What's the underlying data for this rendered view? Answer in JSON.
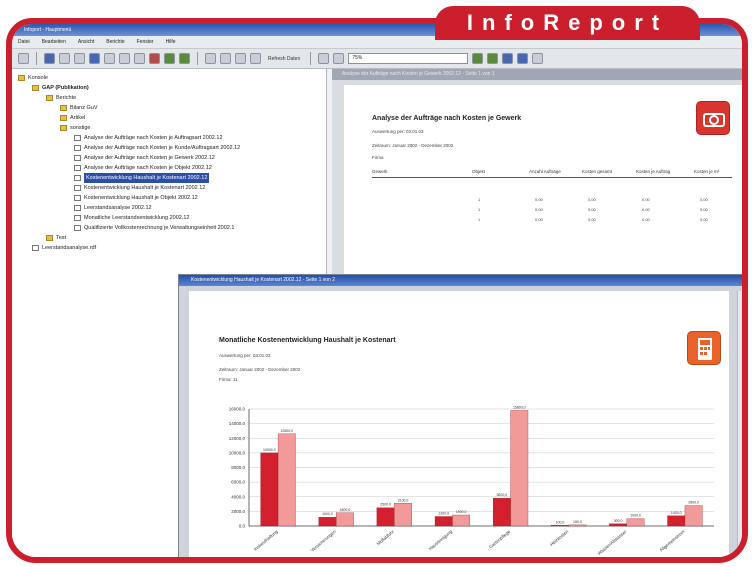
{
  "brand": {
    "name": "InfoReport"
  },
  "window": {
    "title": "Infoport - Hauptmenü"
  },
  "menu": [
    "Datei",
    "Bearbeiten",
    "Ansicht",
    "Berichte",
    "Fenster",
    "Hilfe"
  ],
  "toolbar": {
    "zoom": "75%",
    "refresh_label": "Refresh Daten"
  },
  "tree": {
    "items": [
      {
        "label": "Konsole",
        "depth": 0,
        "icon": "folder-icon"
      },
      {
        "label": "GAP (Publikation)",
        "depth": 1,
        "icon": "folder-icon",
        "bold": true
      },
      {
        "label": "Berichte",
        "depth": 2,
        "icon": "folder-icon"
      },
      {
        "label": "Bilanz GuV",
        "depth": 3,
        "icon": "folder-icon"
      },
      {
        "label": "Artikel",
        "depth": 3,
        "icon": "folder-icon"
      },
      {
        "label": "sonstige",
        "depth": 3,
        "icon": "folder-icon"
      },
      {
        "label": "Analyse der Aufträge nach Kosten je Auftragsart 2002.12",
        "depth": 4,
        "icon": "report-icon"
      },
      {
        "label": "Analyse der Aufträge nach Kosten je Kunde/Auftragsart 2002.12",
        "depth": 4,
        "icon": "report-icon"
      },
      {
        "label": "Analyse der Aufträge nach Kosten je Gewerk 2002.12",
        "depth": 4,
        "icon": "report-icon"
      },
      {
        "label": "Analyse der Aufträge nach Kosten je Objekt 2002.12",
        "depth": 4,
        "icon": "report-icon"
      },
      {
        "label": "Kostenentwicklung Haushalt je Kostenart 2002.12",
        "depth": 4,
        "icon": "report-icon",
        "selected": true
      },
      {
        "label": "Kostenentwicklung Haushalt je Kostenart 2002.12",
        "depth": 4,
        "icon": "report-icon"
      },
      {
        "label": "Kostenentwicklung Haushalt je Objekt 2002.12",
        "depth": 4,
        "icon": "report-icon"
      },
      {
        "label": "Leerstandsanalyse 2002.12",
        "depth": 4,
        "icon": "report-icon"
      },
      {
        "label": "Monatliche Leerstandsentwicklung 2002.12",
        "depth": 4,
        "icon": "report-icon"
      },
      {
        "label": "Qualifizierte Vollkostenrechnung je Verwaltungseinheit 2002.1",
        "depth": 4,
        "icon": "report-icon"
      },
      {
        "label": "Test",
        "depth": 2,
        "icon": "folder-icon"
      },
      {
        "label": "Leerstandsanalyse.rdf",
        "depth": 1,
        "icon": "report-icon"
      }
    ]
  },
  "back_report": {
    "window_title": "Analyse der Aufträge nach Kosten je Gewerk 2002.12 - Seite 1 von 1",
    "heading": "Analyse der Aufträge nach Kosten je Gewerk",
    "created_label": "Auswertung per: 03.01.03",
    "period": "Zeitraum: Januar 2002 - Dezember 2002",
    "firm": "Firma",
    "columns": [
      "Gewerk",
      "Objekt",
      "Anzahl Aufträge",
      "Kosten gesamt",
      "Kosten je Auftrag",
      "Kosten je m²"
    ],
    "rows": [
      [
        "",
        "",
        "",
        "",
        "",
        ""
      ],
      [
        "",
        "1",
        "0,00",
        "0,00",
        "0,00",
        "0,00"
      ],
      [
        "",
        "1",
        "0,00",
        "0,00",
        "0,00",
        "0,00"
      ],
      [
        "",
        "1",
        "0,00",
        "0,00",
        "0,00",
        "0,00"
      ]
    ]
  },
  "front_report": {
    "window_title": "Kostenentwicklung Haushalt je Kostenart 2002.12 - Seite 1 von 2",
    "heading": "Monatliche Kostenentwicklung Haushalt je Kostenart",
    "created_label": "Auswertung per: 03.01.03",
    "period": "Zeitraum: Januar 2002 - Dezember 2002",
    "firm": "Firma: 11"
  },
  "colors": {
    "frame": "#cc1f2e",
    "bar_dark": "#d4202e",
    "bar_light": "#f29a9a"
  },
  "chart_data": {
    "type": "bar",
    "ylim": [
      0,
      16000
    ],
    "y_ticks": [
      "0,0",
      "2000,0",
      "4000,0",
      "6000,0",
      "8000,0",
      "10000,0",
      "12000,0",
      "14000,0",
      "16000,0"
    ],
    "categories": [
      "Instandhaltung",
      "Versicherungen",
      "Müllabfuhr",
      "Hausreinigung",
      "Gartenpflege",
      "Heizkosten",
      "Wasser/Abwasser",
      "Allgemeinstrom"
    ],
    "series": [
      {
        "values": [
          10000,
          1200,
          2500,
          1300,
          3800,
          100,
          300,
          1400
        ]
      },
      {
        "values": [
          12600,
          1800,
          3100,
          1500,
          15800,
          150,
          1000,
          2800
        ]
      }
    ],
    "data_labels": [
      [
        "10000,0",
        "1000,0",
        "2500,0",
        "1300,0",
        "3800,0",
        "100,0",
        "300,0",
        "1400,0"
      ],
      [
        "12600,0",
        "1800,0",
        "3100,0",
        "1500,0",
        "15800,0",
        "150,0",
        "1000,0",
        "2800,0"
      ]
    ]
  }
}
